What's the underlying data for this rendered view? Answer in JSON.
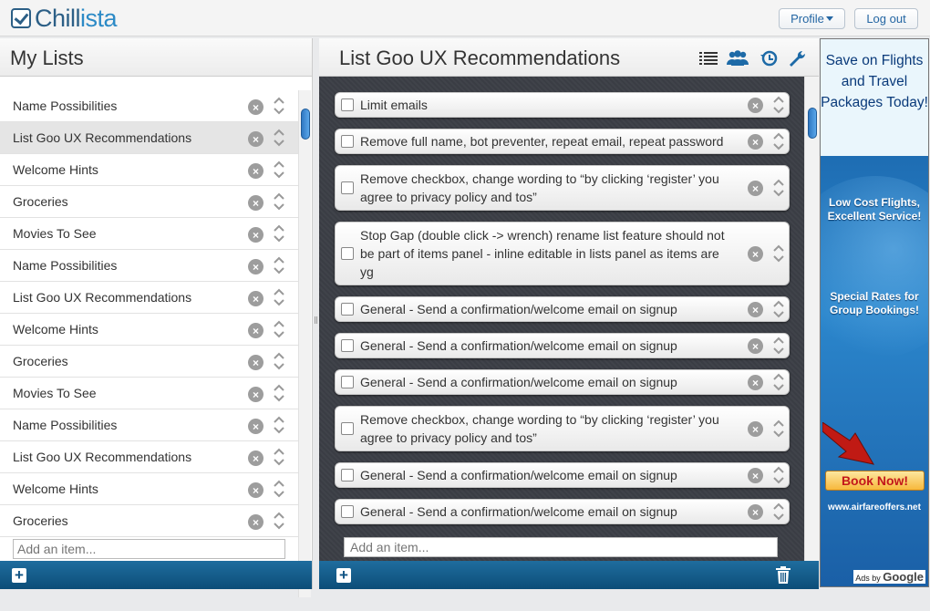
{
  "header": {
    "logo_part1": "Chill",
    "logo_part2": "ista",
    "profile_label": "Profile",
    "logout_label": "Log out"
  },
  "lists_panel": {
    "title": "My Lists",
    "selected_index": 1,
    "items": [
      {
        "label": "Name Possibilities"
      },
      {
        "label": "List Goo UX Recommendations"
      },
      {
        "label": "Welcome Hints"
      },
      {
        "label": "Groceries"
      },
      {
        "label": "Movies To See"
      },
      {
        "label": "Name Possibilities"
      },
      {
        "label": "List Goo UX Recommendations"
      },
      {
        "label": "Welcome Hints"
      },
      {
        "label": "Groceries"
      },
      {
        "label": "Movies To See"
      },
      {
        "label": "Name Possibilities"
      },
      {
        "label": "List Goo UX Recommendations"
      },
      {
        "label": "Welcome Hints"
      },
      {
        "label": "Groceries"
      }
    ],
    "add_placeholder": "Add an item..."
  },
  "items_panel": {
    "title": "List Goo UX Recommendations",
    "toolbar_icons": [
      "list-view-icon",
      "share-users-icon",
      "history-icon",
      "settings-wrench-icon"
    ],
    "items": [
      {
        "text": "Limit emails",
        "lines": 1
      },
      {
        "text": "Remove full name, bot preventer, repeat email, repeat password",
        "lines": 1
      },
      {
        "text": "Remove checkbox, change wording to “by clicking ‘register’ you agree to privacy policy and tos”",
        "lines": 2
      },
      {
        "text": "Stop Gap (double click -> wrench) rename list feature should not be part of items panel - inline editable in lists panel as items are yg",
        "lines": 3
      },
      {
        "text": "General - Send a confirmation/welcome email on signup",
        "lines": 1
      },
      {
        "text": "General - Send a confirmation/welcome email on signup",
        "lines": 1
      },
      {
        "text": "General - Send a confirmation/welcome email on signup",
        "lines": 1
      },
      {
        "text": "Remove checkbox, change wording to “by clicking ‘register’ you agree to privacy policy and tos”",
        "lines": 2
      },
      {
        "text": "General - Send a confirmation/welcome email on signup",
        "lines": 1
      },
      {
        "text": "General - Send a confirmation/welcome email on signup",
        "lines": 1
      }
    ],
    "add_placeholder": "Add an item..."
  },
  "ad": {
    "headline": "Save on Flights and Travel Packages Today!",
    "line1": "Low Cost Flights, Excellent Service!",
    "line2": "Special Rates for Group Bookings!",
    "button": "Book Now!",
    "url": "www.airfareoffers.net",
    "ads_by": "Ads by",
    "ads_brand": "Google"
  },
  "colors": {
    "accent": "#2c5f86",
    "footer_blue": "#0c4d78",
    "items_bg": "#3a3d44"
  }
}
